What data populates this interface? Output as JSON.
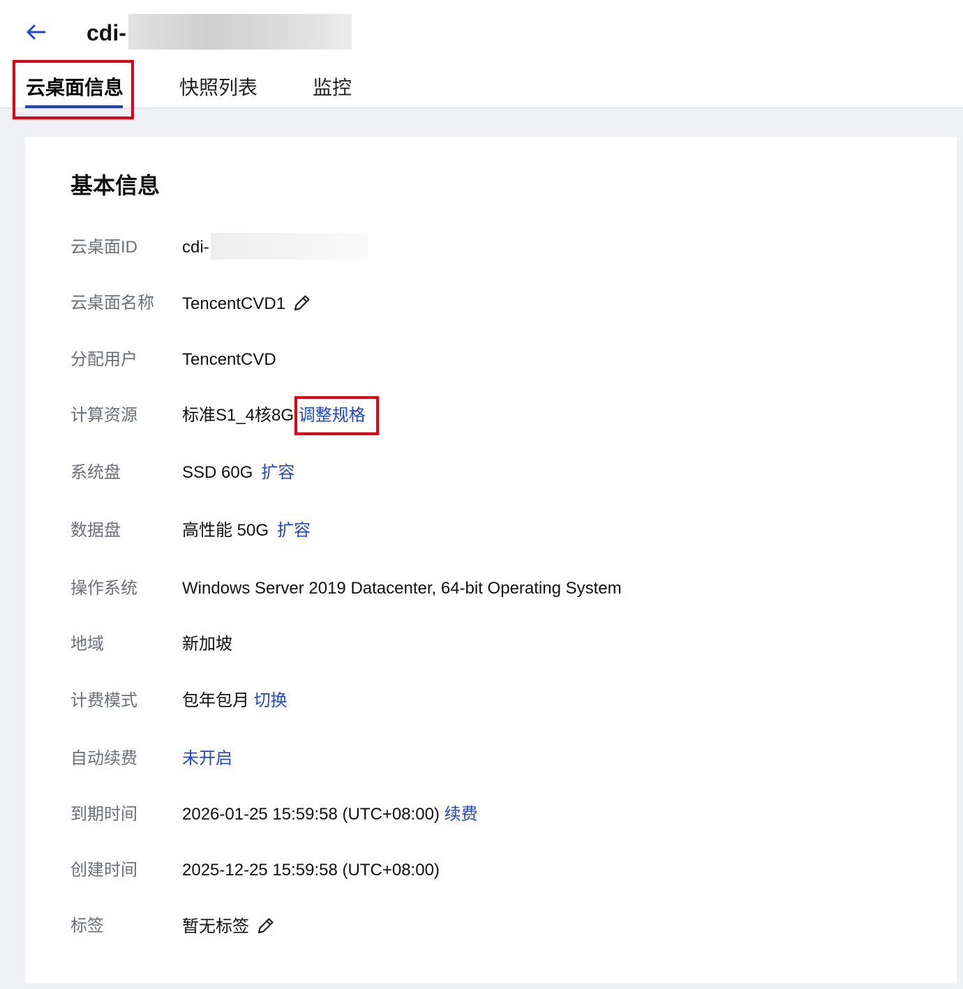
{
  "header": {
    "title_prefix": "cdi-",
    "tabs": [
      {
        "label": "云桌面信息",
        "active": true
      },
      {
        "label": "快照列表",
        "active": false
      },
      {
        "label": "监控",
        "active": false
      }
    ]
  },
  "section": {
    "title": "基本信息",
    "rows": [
      {
        "label": "云桌面ID",
        "value": "cdi-"
      },
      {
        "label": "云桌面名称",
        "value": "TencentCVD1",
        "icon": "pencil-icon"
      },
      {
        "label": "分配用户",
        "value": "TencentCVD"
      },
      {
        "label": "计算资源",
        "value": "标准S1_4核8G",
        "link": "调整规格"
      },
      {
        "label": "系统盘",
        "value": "SSD 60G",
        "link": "扩容"
      },
      {
        "label": "数据盘",
        "value": "高性能 50G",
        "link": "扩容"
      },
      {
        "label": "操作系统",
        "value": "Windows Server 2019 Datacenter, 64-bit Operating System"
      },
      {
        "label": "地域",
        "value": "新加坡"
      },
      {
        "label": "计费模式",
        "value": "包年包月",
        "link": "切换"
      },
      {
        "label": "自动续费",
        "link": "未开启"
      },
      {
        "label": "到期时间",
        "value": "2026-01-25 15:59:58 (UTC+08:00)",
        "link": "续费"
      },
      {
        "label": "创建时间",
        "value": "2025-12-25 15:59:58 (UTC+08:00)"
      },
      {
        "label": "标签",
        "value": "暂无标签",
        "icon": "pencil-icon"
      }
    ]
  },
  "colors": {
    "link": "#1f45d9",
    "active_tab_underline": "#1f3fd2",
    "highlight_box": "#e60012",
    "page_background": "#f0f1f5"
  }
}
